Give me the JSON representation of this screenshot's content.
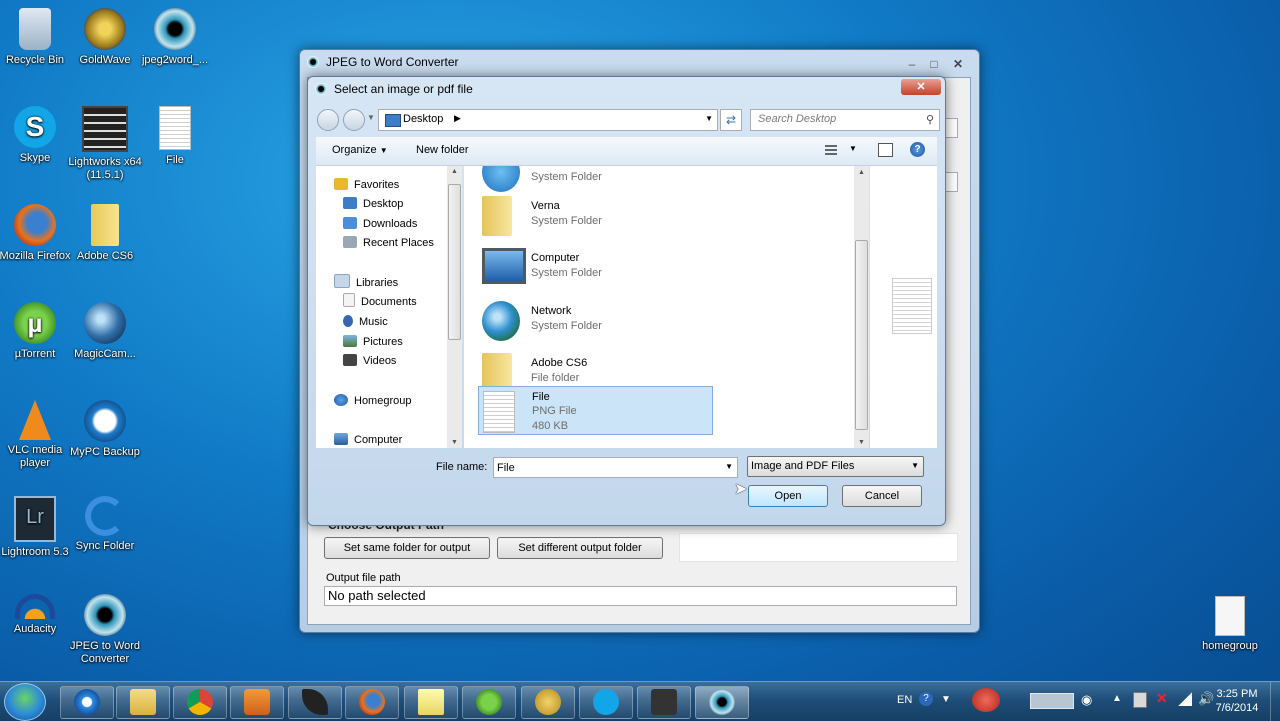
{
  "desktop": {
    "icons": [
      {
        "label": "Recycle Bin"
      },
      {
        "label": "GoldWave"
      },
      {
        "label": "jpeg2word_..."
      },
      {
        "label": "Skype"
      },
      {
        "label": "Lightworks x64 (11.5.1)"
      },
      {
        "label": "File"
      },
      {
        "label": "Mozilla Firefox"
      },
      {
        "label": "Adobe CS6"
      },
      {
        "label": "µTorrent"
      },
      {
        "label": "MagicCam..."
      },
      {
        "label": "VLC media player"
      },
      {
        "label": "MyPC Backup"
      },
      {
        "label": "Lightroom 5.3"
      },
      {
        "label": "Sync Folder"
      },
      {
        "label": "Audacity"
      },
      {
        "label": "JPEG to Word Converter"
      },
      {
        "label": "homegroup"
      }
    ]
  },
  "main_window": {
    "title": "JPEG to Word Converter",
    "section_label": "Choose Output Path",
    "same_folder_button": "Set same folder for output",
    "different_folder_button": "Set different output folder",
    "output_path_label": "Output file path",
    "output_path_value": "No path selected"
  },
  "dialog": {
    "title": "Select an image or pdf file",
    "address": "Desktop",
    "search_placeholder": "Search Desktop",
    "organize_label": "Organize",
    "new_folder_label": "New folder",
    "nav": {
      "favorites": "Favorites",
      "desktop": "Desktop",
      "downloads": "Downloads",
      "recent_places": "Recent Places",
      "libraries": "Libraries",
      "documents": "Documents",
      "music": "Music",
      "pictures": "Pictures",
      "videos": "Videos",
      "homegroup": "Homegroup",
      "computer": "Computer"
    },
    "files": [
      {
        "name": "",
        "type": "System Folder",
        "icon": "libraries-icon"
      },
      {
        "name": "Verna",
        "type": "System Folder",
        "icon": "user-folder-icon"
      },
      {
        "name": "Computer",
        "type": "System Folder",
        "icon": "computer-icon"
      },
      {
        "name": "Network",
        "type": "System Folder",
        "icon": "network-icon"
      },
      {
        "name": "Adobe CS6",
        "type": "File folder",
        "icon": "folder-icon"
      },
      {
        "name": "File",
        "type": "PNG File",
        "size": "480 KB",
        "icon": "png-file-icon"
      }
    ],
    "file_name_label": "File name:",
    "file_name_value": "File",
    "file_type_value": "Image and PDF Files",
    "open_button": "Open",
    "cancel_button": "Cancel"
  },
  "taskbar": {
    "language": "EN",
    "time": "3:25 PM",
    "date": "7/6/2014"
  },
  "colors": {
    "selection": "#cce4f7",
    "selection_border": "#84acdd",
    "desktop_blue": "#117bc7"
  }
}
